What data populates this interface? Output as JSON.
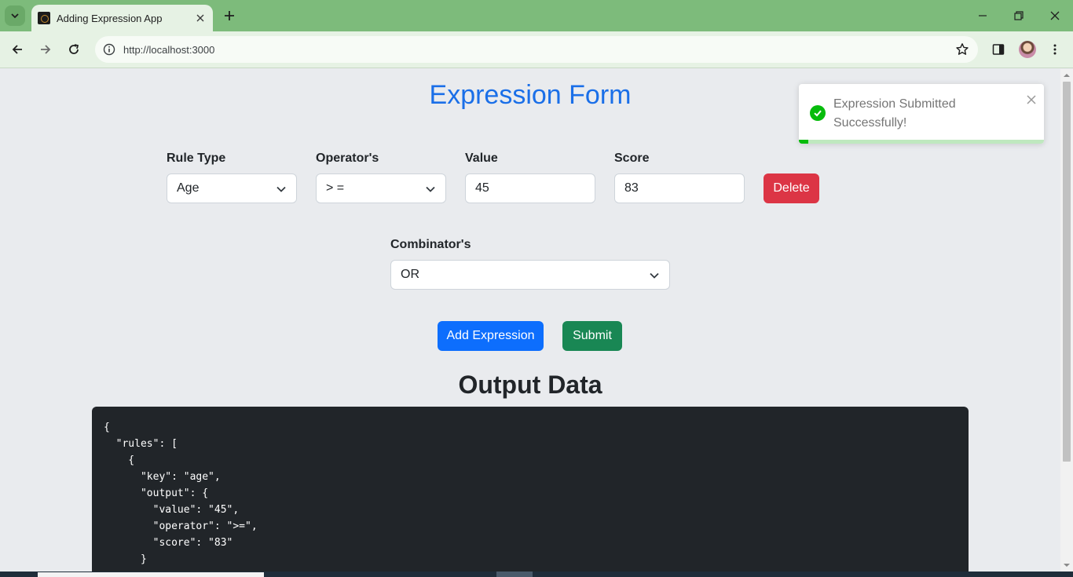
{
  "browser": {
    "tab_title": "Adding Expression App",
    "url": "http://localhost:3000"
  },
  "form": {
    "title": "Expression Form",
    "rule_type_label": "Rule Type",
    "rule_type_value": "Age",
    "operator_label": "Operator's",
    "operator_value": "> =",
    "value_label": "Value",
    "value_value": "45",
    "score_label": "Score",
    "score_value": "83",
    "delete_label": "Delete",
    "combinator_label": "Combinator's",
    "combinator_value": "OR",
    "add_label": "Add Expression",
    "submit_label": "Submit"
  },
  "output": {
    "title": "Output Data",
    "lines": [
      "{",
      "  \"rules\": [",
      "    {",
      "      \"key\": \"age\",",
      "      \"output\": {",
      "        \"value\": \"45\",",
      "        \"operator\": \">=\",",
      "        \"score\": \"83\"",
      "      }"
    ]
  },
  "toast": {
    "message": "Expression Submitted Successfully!",
    "progress": 0.04
  },
  "colors": {
    "accent": "#1a6fe8",
    "danger": "#dc3545",
    "primary": "#0d6efd",
    "success": "#198754",
    "toast_success": "#07bc0c"
  }
}
